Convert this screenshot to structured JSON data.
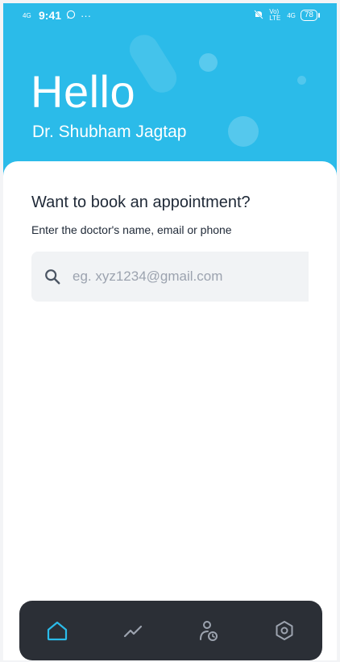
{
  "status_bar": {
    "network": "4G",
    "time": "9:41",
    "extra": "···",
    "volte": "Vo) LTE",
    "network_right": "4G",
    "battery": "78"
  },
  "header": {
    "greeting": "Hello",
    "user_name": "Dr. Shubham Jagtap"
  },
  "booking": {
    "title": "Want to book an appointment?",
    "subtitle": "Enter the doctor's name, email or phone",
    "search_placeholder": "eg. xyz1234@gmail.com",
    "search_value": ""
  },
  "nav": {
    "tabs": [
      {
        "icon": "home-icon",
        "active": true
      },
      {
        "icon": "activity-chart-icon",
        "active": false
      },
      {
        "icon": "patient-schedule-icon",
        "active": false
      },
      {
        "icon": "settings-icon",
        "active": false
      }
    ]
  },
  "colors": {
    "accent": "#2bbbe9",
    "nav_background": "#2b2f36",
    "active_icon": "#2bbbe9",
    "inactive_icon": "#9ca3af"
  }
}
